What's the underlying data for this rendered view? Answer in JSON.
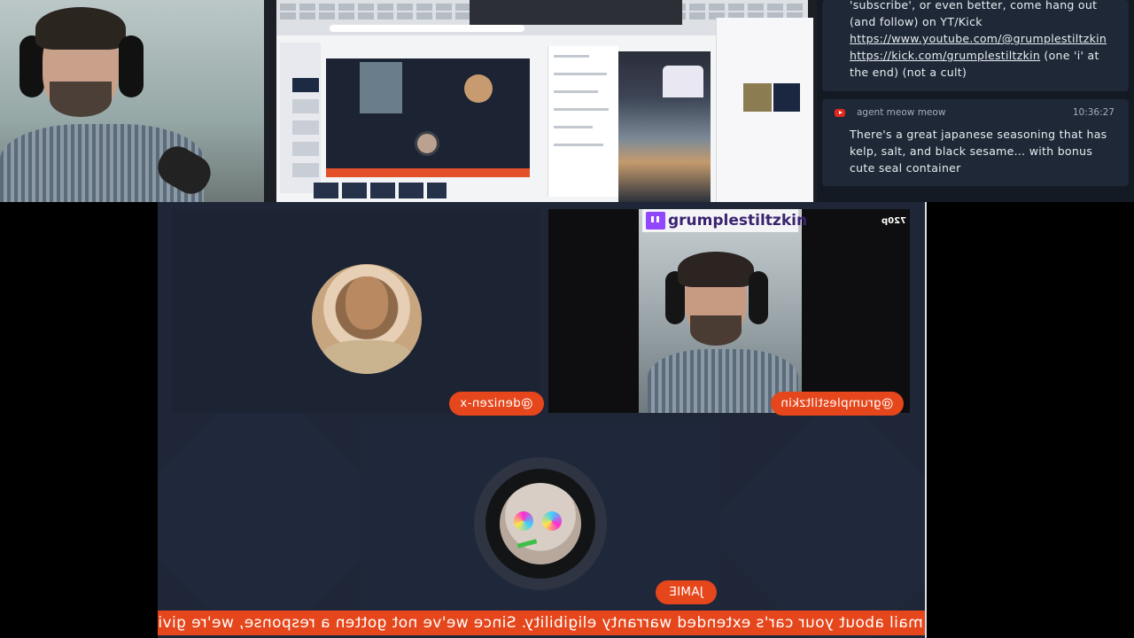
{
  "chat": {
    "messages": [
      {
        "text_prefix": "'subscribe', or even better, come hang out (and follow) on YT/Kick",
        "link1": "https://www.youtube.com/@grumplestiltzkin",
        "link2": "https://kick.com/grumplestiltzkin",
        "text_suffix": " (one 'i' at the end) (not a cult)"
      },
      {
        "platform_icon": "youtube-icon",
        "author": "agent meow meow",
        "time": "10:36:27",
        "text": "There's a great japanese seasoning that has kelp, salt, and black sesame... with bonus cute seal container"
      }
    ]
  },
  "stage": {
    "participants": [
      {
        "label": "@denizen-x"
      },
      {
        "label": "@grumplestiltzkin",
        "banner": "grumplestiltzkin",
        "quality": "720p"
      },
      {
        "label": "JAMIE"
      }
    ],
    "ticker": "otice in the mail about your car's extended warranty eligibility. Since we've not gotten a response, we're givi"
  },
  "colors": {
    "accent": "#e6461b",
    "chat_bg": "#1f2836",
    "stage_bg": "#1e2637",
    "twitch": "#9146ff",
    "youtube": "#e3281f"
  }
}
